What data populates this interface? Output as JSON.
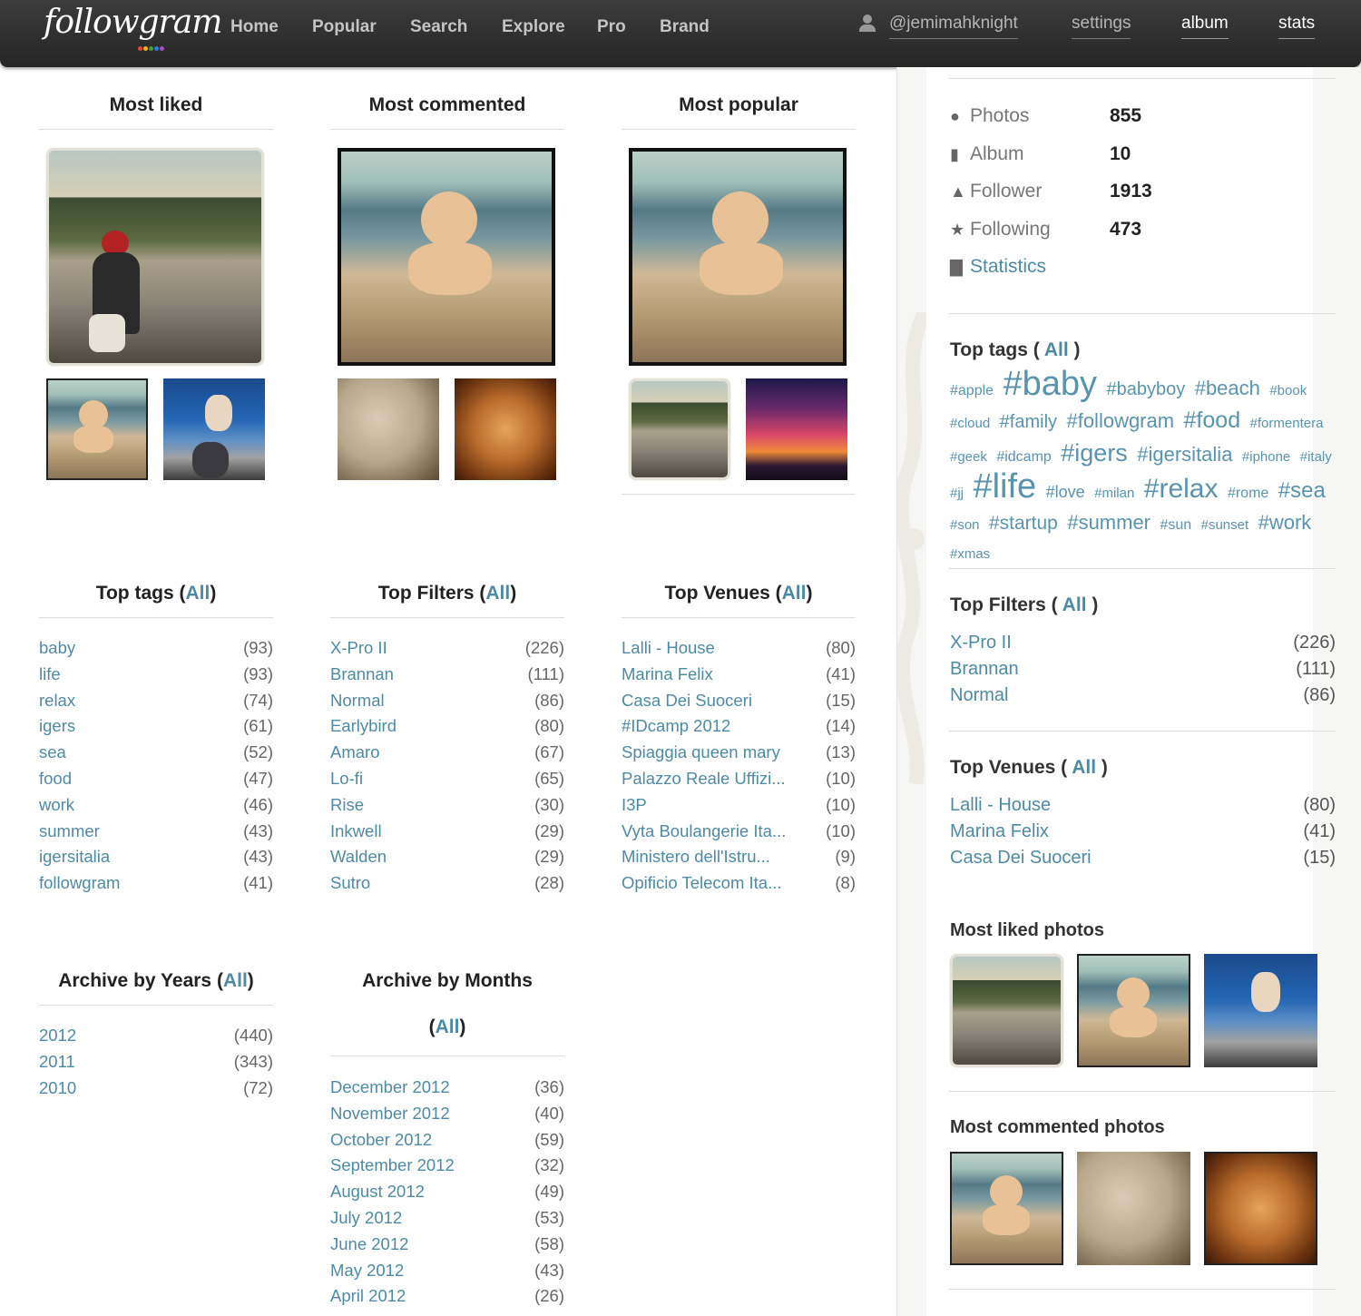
{
  "nav": {
    "logo": "followgram",
    "logo_dots": [
      "#e9442e",
      "#f2b21a",
      "#3d9e4a",
      "#2d7fd3",
      "#b04bc4"
    ],
    "links": [
      "Home",
      "Popular",
      "Search",
      "Explore",
      "Pro",
      "Brand"
    ],
    "username": "@jemimahknight",
    "settings": "settings",
    "album": "album",
    "stats": "stats"
  },
  "top_photos": {
    "most_liked": "Most liked",
    "most_commented": "Most commented",
    "most_popular": "Most popular"
  },
  "lists": {
    "all": "All",
    "top_tags": {
      "title": "Top tags",
      "rows": [
        [
          "baby",
          "(93)"
        ],
        [
          "life",
          "(93)"
        ],
        [
          "relax",
          "(74)"
        ],
        [
          "igers",
          "(61)"
        ],
        [
          "sea",
          "(52)"
        ],
        [
          "food",
          "(47)"
        ],
        [
          "work",
          "(46)"
        ],
        [
          "summer",
          "(43)"
        ],
        [
          "igersitalia",
          "(43)"
        ],
        [
          "followgram",
          "(41)"
        ]
      ]
    },
    "top_filters": {
      "title": "Top Filters",
      "rows": [
        [
          "X-Pro II",
          "(226)"
        ],
        [
          "Brannan",
          "(111)"
        ],
        [
          "Normal",
          "(86)"
        ],
        [
          "Earlybird",
          "(80)"
        ],
        [
          "Amaro",
          "(67)"
        ],
        [
          "Lo-fi",
          "(65)"
        ],
        [
          "Rise",
          "(30)"
        ],
        [
          "Inkwell",
          "(29)"
        ],
        [
          "Walden",
          "(29)"
        ],
        [
          "Sutro",
          "(28)"
        ]
      ]
    },
    "top_venues": {
      "title": "Top Venues",
      "rows": [
        [
          "Lalli - House",
          "(80)"
        ],
        [
          "Marina Felix",
          "(41)"
        ],
        [
          "Casa Dei Suoceri",
          "(15)"
        ],
        [
          "#IDcamp 2012",
          "(14)"
        ],
        [
          "Spiaggia queen mary",
          "(13)"
        ],
        [
          "Palazzo Reale Uffizi...",
          "(10)"
        ],
        [
          "I3P",
          "(10)"
        ],
        [
          "Vyta Boulangerie Ita...",
          "(10)"
        ],
        [
          "Ministero dell'Istru...",
          "(9)"
        ],
        [
          "Opificio Telecom Ita...",
          "(8)"
        ]
      ]
    },
    "archive_years": {
      "title": "Archive by Years",
      "rows": [
        [
          "2012",
          "(440)"
        ],
        [
          "2011",
          "(343)"
        ],
        [
          "2010",
          "(72)"
        ]
      ]
    },
    "archive_months": {
      "title": "Archive by Months",
      "rows": [
        [
          "December 2012",
          "(36)"
        ],
        [
          "November 2012",
          "(40)"
        ],
        [
          "October 2012",
          "(59)"
        ],
        [
          "September 2012",
          "(32)"
        ],
        [
          "August 2012",
          "(49)"
        ],
        [
          "July 2012",
          "(53)"
        ],
        [
          "June 2012",
          "(58)"
        ],
        [
          "May 2012",
          "(43)"
        ],
        [
          "April 2012",
          "(26)"
        ]
      ]
    }
  },
  "sidebar": {
    "stats": [
      {
        "label": "Photos",
        "value": "855",
        "icon": "drop-icon"
      },
      {
        "label": "Album",
        "value": "10",
        "icon": "book-icon"
      },
      {
        "label": "Follower",
        "value": "1913",
        "icon": "person-icon"
      },
      {
        "label": "Following",
        "value": "473",
        "icon": "star-icon"
      }
    ],
    "statistics_link": "Statistics",
    "top_tags_title": "Top tags (",
    "close_paren": " )",
    "all": "All",
    "tag_cloud": [
      {
        "t": "#apple",
        "s": 16
      },
      {
        "t": "#baby",
        "s": 38
      },
      {
        "t": "#babyboy",
        "s": 20
      },
      {
        "t": "#beach",
        "s": 22
      },
      {
        "t": "#book",
        "s": 15
      },
      {
        "t": "#cloud",
        "s": 15
      },
      {
        "t": "#family",
        "s": 20
      },
      {
        "t": "#followgram",
        "s": 22
      },
      {
        "t": "#food",
        "s": 25
      },
      {
        "t": "#formentera",
        "s": 15
      },
      {
        "t": "#geek",
        "s": 15
      },
      {
        "t": "#idcamp",
        "s": 16
      },
      {
        "t": "#igers",
        "s": 27
      },
      {
        "t": "#igersitalia",
        "s": 22
      },
      {
        "t": "#iphone",
        "s": 15
      },
      {
        "t": "#italy",
        "s": 15
      },
      {
        "t": "#jj",
        "s": 15
      },
      {
        "t": "#life",
        "s": 38
      },
      {
        "t": "#love",
        "s": 18
      },
      {
        "t": "#milan",
        "s": 15
      },
      {
        "t": "#relax",
        "s": 30
      },
      {
        "t": "#rome",
        "s": 16
      },
      {
        "t": "#sea",
        "s": 24
      },
      {
        "t": "#son",
        "s": 15
      },
      {
        "t": "#startup",
        "s": 21
      },
      {
        "t": "#summer",
        "s": 22
      },
      {
        "t": "#sun",
        "s": 16
      },
      {
        "t": "#sunset",
        "s": 15
      },
      {
        "t": "#work",
        "s": 22
      },
      {
        "t": "#xmas",
        "s": 15
      }
    ],
    "top_filters_title": "Top Filters (",
    "top_filters": [
      [
        "X-Pro II",
        "(226)"
      ],
      [
        "Brannan",
        "(111)"
      ],
      [
        "Normal",
        "(86)"
      ]
    ],
    "top_venues_title": "Top Venues (",
    "top_venues": [
      [
        "Lalli - House",
        "(80)"
      ],
      [
        "Marina Felix",
        "(41)"
      ],
      [
        "Casa Dei Suoceri",
        "(15)"
      ]
    ],
    "most_liked_photos": "Most liked photos",
    "most_commented_photos": "Most commented photos"
  }
}
